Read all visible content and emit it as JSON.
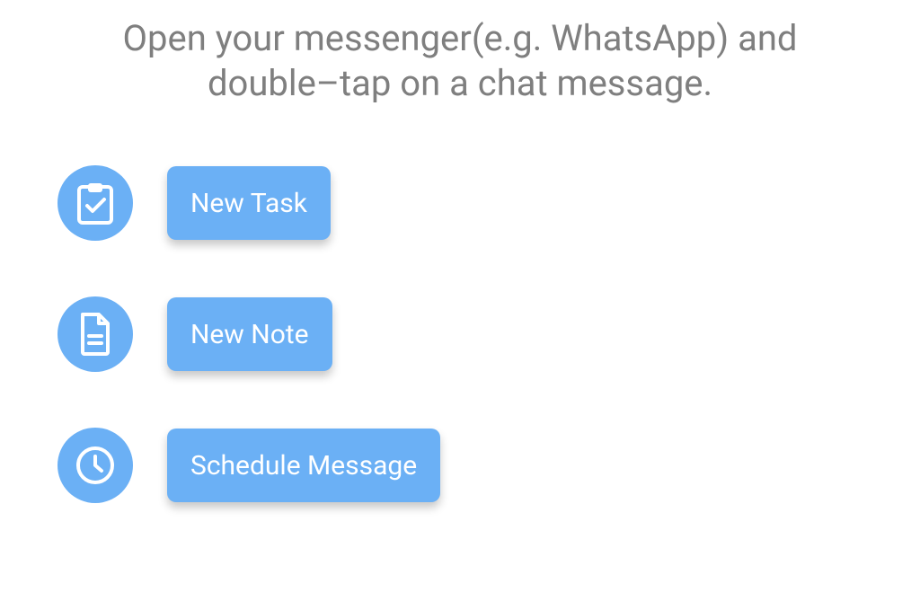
{
  "instruction": "Open your messenger(e.g. WhatsApp) and double–tap on a chat message.",
  "actions": {
    "new_task": {
      "label": "New Task"
    },
    "new_note": {
      "label": "New Note"
    },
    "schedule_message": {
      "label": "Schedule Message"
    }
  },
  "colors": {
    "accent": "#6bb0f5",
    "instruction_text": "#7f7f7f",
    "button_text": "#ffffff"
  }
}
